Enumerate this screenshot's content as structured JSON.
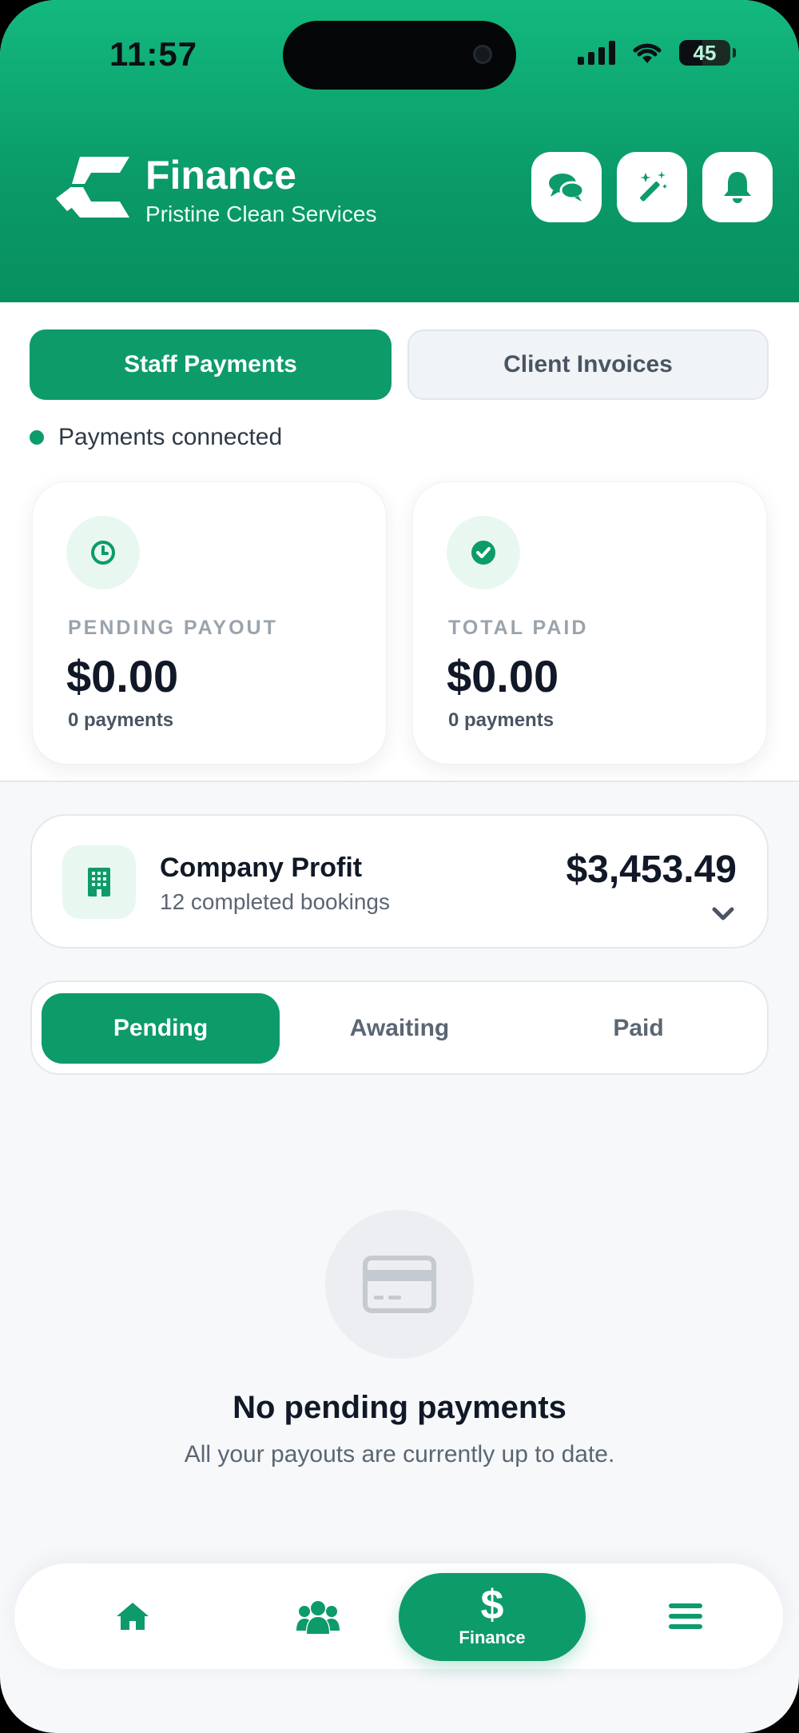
{
  "status": {
    "time": "11:57",
    "battery": "45"
  },
  "header": {
    "title": "Finance",
    "subtitle": "Pristine Clean Services",
    "icons": [
      "chat-icon",
      "magic-wand-icon",
      "bell-icon"
    ]
  },
  "tabs": {
    "staff": "Staff Payments",
    "client": "Client Invoices"
  },
  "connection": {
    "label": "Payments connected"
  },
  "stats": {
    "pending": {
      "label": "PENDING PAYOUT",
      "value": "$0.00",
      "count": "0 payments"
    },
    "paid": {
      "label": "TOTAL PAID",
      "value": "$0.00",
      "count": "0 payments"
    }
  },
  "profit": {
    "title": "Company Profit",
    "subtitle": "12 completed bookings",
    "amount": "$3,453.49"
  },
  "filters": {
    "pending": "Pending",
    "awaiting": "Awaiting",
    "paid": "Paid"
  },
  "empty": {
    "title": "No pending payments",
    "subtitle": "All your payouts are currently up to date."
  },
  "nav": {
    "finance": "Finance"
  },
  "colors": {
    "accent": "#0d9b6a",
    "header_top": "#13b97f",
    "header_bottom": "#08905f"
  }
}
